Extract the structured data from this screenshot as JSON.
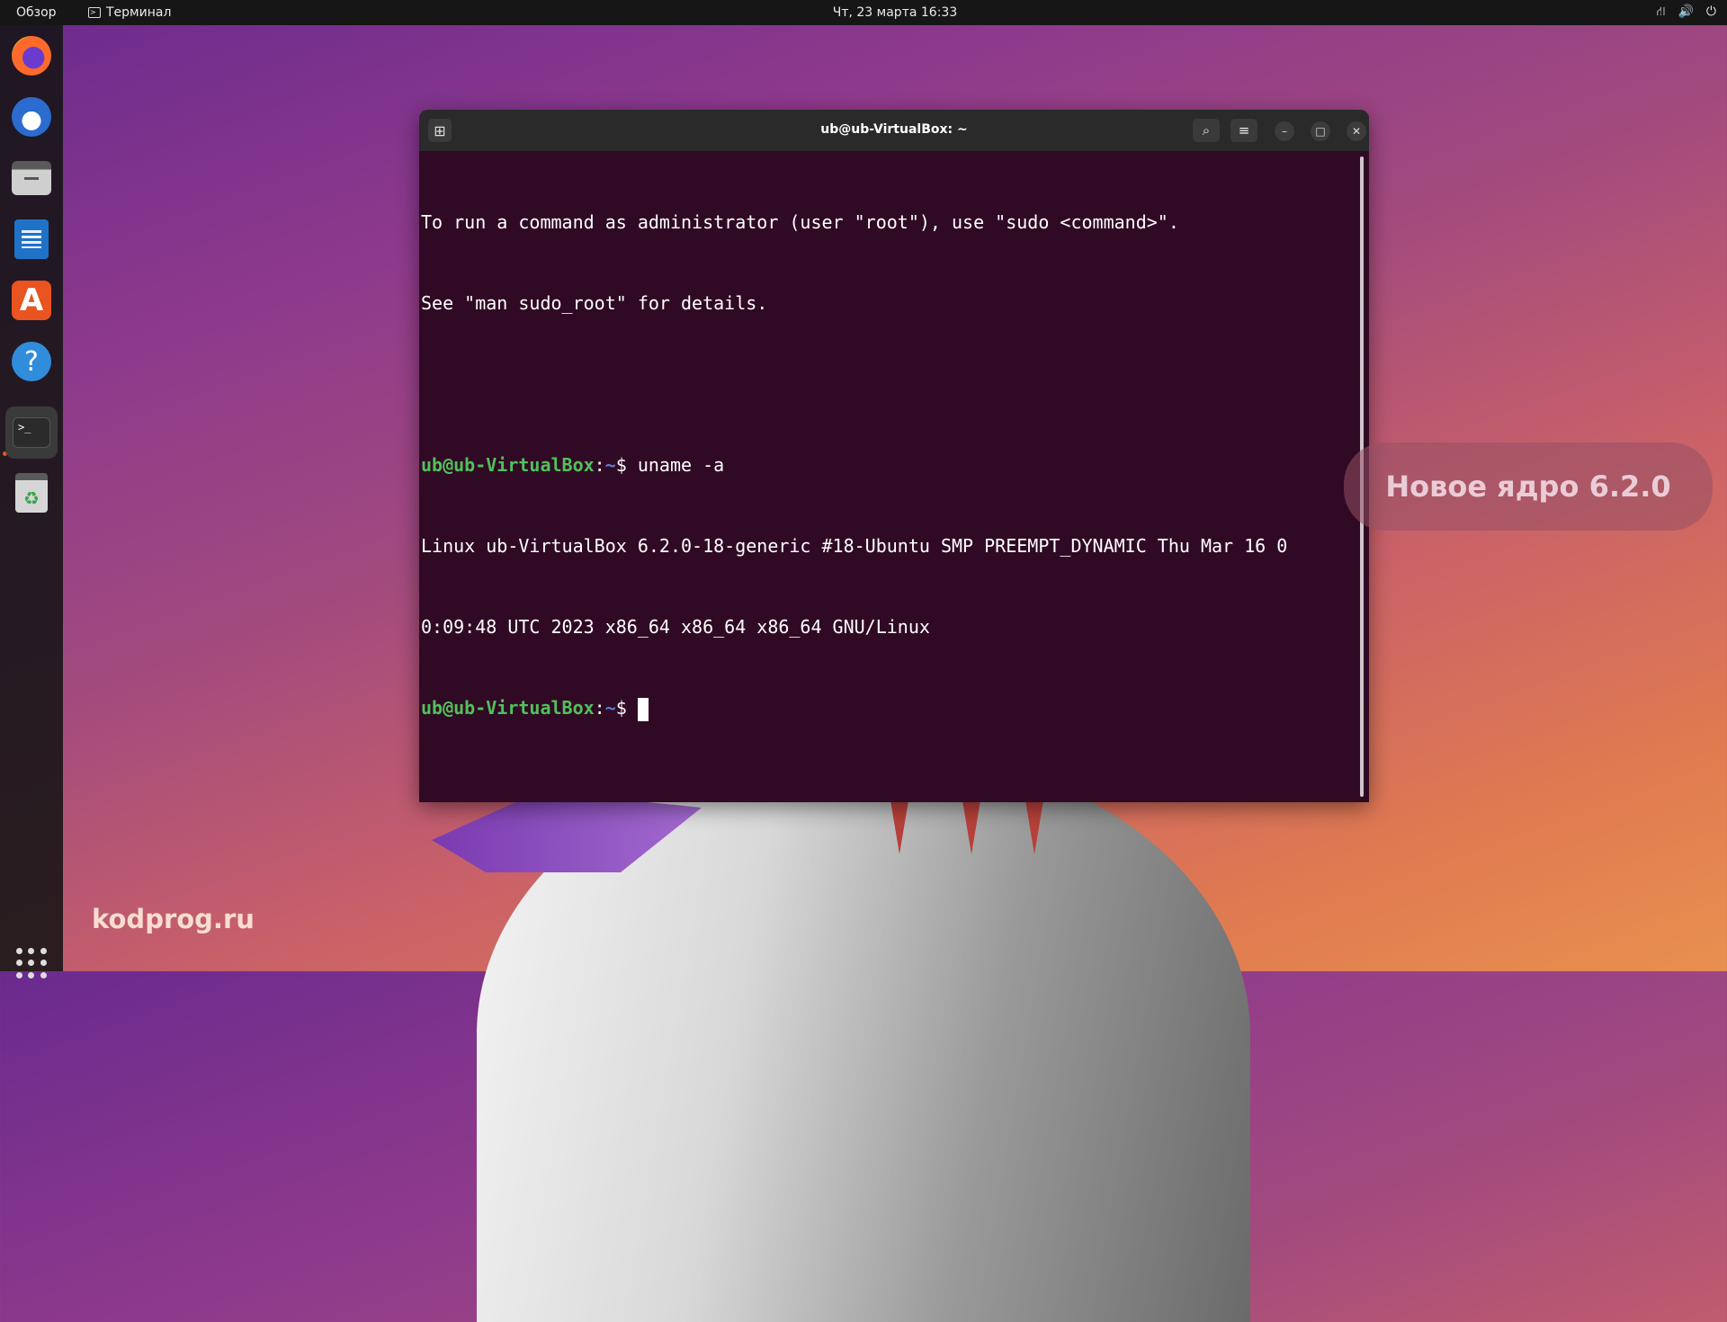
{
  "topbar": {
    "activities": "Обзор",
    "app_name": "Терминал",
    "clock": "Чт, 23 марта  16:33"
  },
  "dock": {
    "apps": [
      "firefox-icon",
      "thunderbird-icon",
      "files-icon",
      "writer-icon",
      "software-icon",
      "help-icon",
      "terminal-icon",
      "trash-icon"
    ],
    "terminal_prompt_glyph": ">_"
  },
  "terminal": {
    "title": "ub@ub-VirtualBox: ~",
    "lines": {
      "l1": "To run a command as administrator (user \"root\"), use \"sudo <command>\".",
      "l2": "See \"man sudo_root\" for details.",
      "cmd1_user": "ub@ub-VirtualBox",
      "cmd1_sep": ":",
      "cmd1_path": "~",
      "cmd1_dollar": "$ ",
      "cmd1_text": "uname -a",
      "out1": "Linux ub-VirtualBox 6.2.0-18-generic #18-Ubuntu SMP PREEMPT_DYNAMIC Thu Mar 16 0",
      "out2": "0:09:48 UTC 2023 x86_64 x86_64 x86_64 GNU/Linux",
      "cmd2_user": "ub@ub-VirtualBox",
      "cmd2_sep": ":",
      "cmd2_path": "~",
      "cmd2_dollar": "$ "
    }
  },
  "overlay": {
    "osd_text": "Новое ядро 6.2.0",
    "watermark": "kodprog.ru"
  },
  "colors": {
    "terminal_bg": "#300a24",
    "prompt_user": "#4fc25a",
    "prompt_path": "#5a7fd0",
    "accent": "#e95420"
  }
}
